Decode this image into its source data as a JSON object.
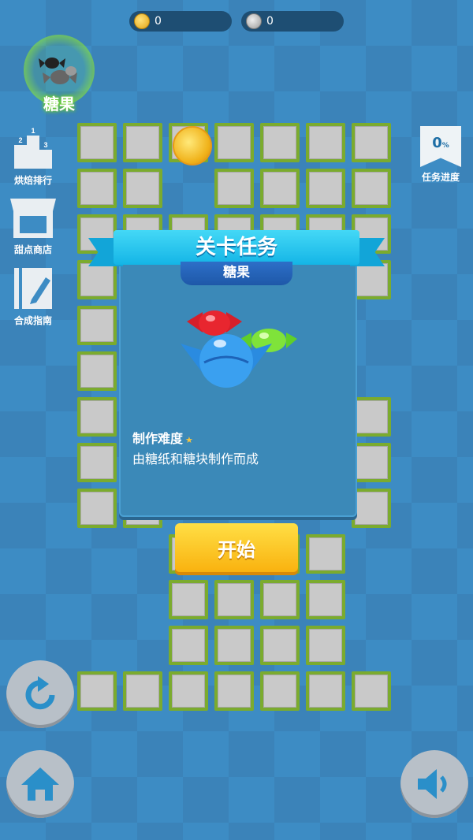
{
  "currency": {
    "gold": "0",
    "silver": "0"
  },
  "target": {
    "label": "糖果"
  },
  "sidebar": {
    "items": [
      {
        "label": "烘焙排行",
        "ranks": [
          "1",
          "2",
          "3"
        ]
      },
      {
        "label": "甜点商店"
      },
      {
        "label": "合成指南"
      }
    ]
  },
  "task_progress": {
    "value": "0",
    "unit": "%",
    "label": "任务进度"
  },
  "modal": {
    "title": "关卡任务",
    "subtitle": "糖果",
    "difficulty_label": "制作难度",
    "difficulty_stars": 1,
    "description": "由糖纸和糖块制作而成",
    "start_label": "开始"
  },
  "colors": {
    "accent": "#14b5e6",
    "button": "#f9b20f",
    "grid_border": "#7bab2e"
  },
  "icons": [
    "gold-coin-icon",
    "silver-coin-icon",
    "podium-icon",
    "shop-icon",
    "guide-icon",
    "undo-icon",
    "home-icon",
    "sound-icon"
  ]
}
